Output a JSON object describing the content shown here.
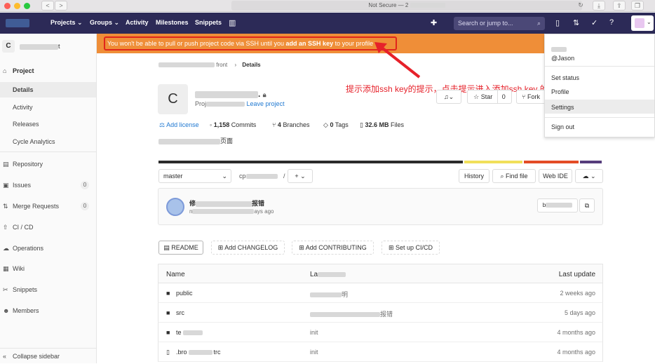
{
  "browser": {
    "url_text": "Not Secure — 2",
    "nav_back": "<",
    "nav_fwd": ">"
  },
  "navbar": {
    "items": [
      {
        "label": "Projects ⌄"
      },
      {
        "label": "Groups ⌄"
      },
      {
        "label": "Activity"
      },
      {
        "label": "Milestones"
      },
      {
        "label": "Snippets"
      }
    ],
    "search_placeholder": "Search or jump to...",
    "search_icon": "⌕",
    "plus_icon": "✚",
    "help_icon": "?"
  },
  "sidebar": {
    "project_initial": "C",
    "project_name": "t",
    "section_title": "Project",
    "sub_items": [
      "Details",
      "Activity",
      "Releases",
      "Cycle Analytics"
    ],
    "items": [
      {
        "label": "Repository",
        "count": ""
      },
      {
        "label": "Issues",
        "count": "0"
      },
      {
        "label": "Merge Requests",
        "count": "0"
      },
      {
        "label": "CI / CD",
        "count": ""
      },
      {
        "label": "Operations",
        "count": ""
      },
      {
        "label": "Wiki",
        "count": ""
      },
      {
        "label": "Snippets",
        "count": ""
      },
      {
        "label": "Members",
        "count": ""
      }
    ],
    "collapse_label": "Collapse sidebar"
  },
  "banner": {
    "part1": "You won't be able to pull or push project code via SSH until you ",
    "bold": "add an SSH key",
    "part2": " to your profile"
  },
  "breadcrumb": {
    "part": "front",
    "current": "Details"
  },
  "project": {
    "initial": "C",
    "name_suffix": ".",
    "sub_prefix": "Proj",
    "leave_link": "Leave project",
    "add_license": "Add license",
    "commits": "1,158",
    "commits_label": "Commits",
    "branches": "4",
    "branches_label": "Branches",
    "tags": "0",
    "tags_label": "Tags",
    "files_size": "32.6 MB",
    "files_label": "Files",
    "description_suffix": "页面",
    "star_label": "Star",
    "star_count": "0",
    "fork_label": "Fork"
  },
  "lang_bar": {
    "colors": [
      "#2b2b2b",
      "#f1e05a",
      "#e34c26",
      "#563d7c"
    ],
    "shares": [
      0.688,
      0.134,
      0.126,
      0.052
    ]
  },
  "annotation": "提示添加ssh key的提示，点击提示进入添加ssh key 的具体位置",
  "repo_bar": {
    "branch": "master",
    "path_prefix": "cp",
    "separator": "/",
    "add_btn": "+ ⌄",
    "history": "History",
    "find_file": "Find file",
    "web_ide": "Web IDE",
    "clone_btn": "⌄"
  },
  "commit": {
    "msg_prefix": "修",
    "msg_suffix": "报错",
    "author_prefix": "n",
    "time_suffix": "ays ago",
    "sha_prefix": "b",
    "copy_icon": "⧉"
  },
  "actions": [
    {
      "label": "README",
      "icon": "▤"
    },
    {
      "label": "Add CHANGELOG",
      "icon": "⊞"
    },
    {
      "label": "Add CONTRIBUTING",
      "icon": "⊞"
    },
    {
      "label": "Set up CI/CD",
      "icon": "⊞"
    }
  ],
  "table": {
    "col_name": "Name",
    "col_commit": "La",
    "col_update": "Last update",
    "rows": [
      {
        "icon": "folder",
        "name": "public",
        "commit_suffix": "明",
        "update": "2 weeks ago"
      },
      {
        "icon": "folder",
        "name": "src",
        "commit_suffix": "报错",
        "update": "5 days ago"
      },
      {
        "icon": "folder",
        "name": "te",
        "commit_suffix": "init",
        "update": "4 months ago"
      },
      {
        "icon": "file",
        "name": ".bro",
        "name_suffix": "trc",
        "commit_suffix": "init",
        "update": "4 months ago"
      }
    ]
  },
  "user_menu": {
    "handle": "@Jason",
    "items": [
      "Set status",
      "Profile",
      "Settings",
      "Sign out"
    ]
  }
}
